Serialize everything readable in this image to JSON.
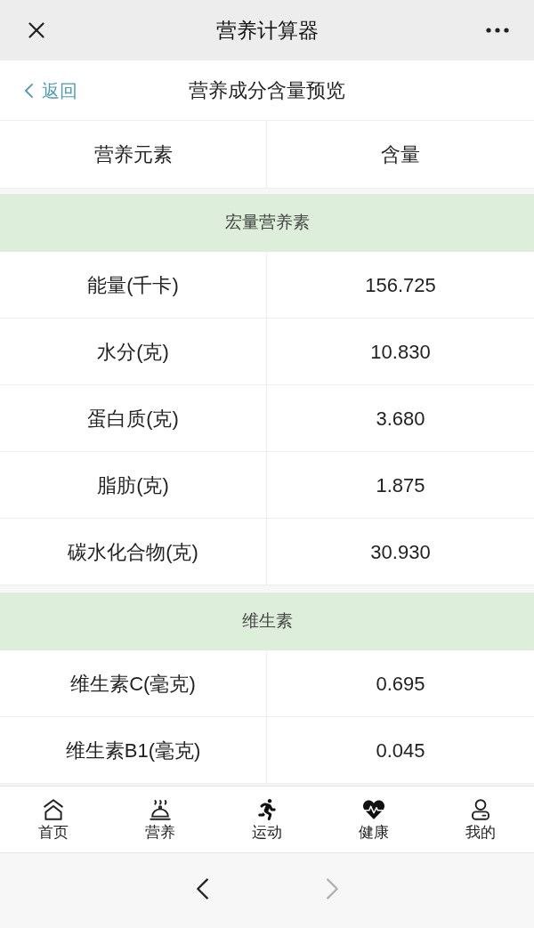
{
  "window": {
    "title": "营养计算器"
  },
  "header": {
    "back_label": "返回",
    "title": "营养成分含量预览"
  },
  "table": {
    "columns": [
      "营养元素",
      "含量"
    ],
    "sections": [
      {
        "title": "宏量营养素",
        "rows": [
          {
            "name": "能量(千卡)",
            "value": "156.725"
          },
          {
            "name": "水分(克)",
            "value": "10.830"
          },
          {
            "name": "蛋白质(克)",
            "value": "3.680"
          },
          {
            "name": "脂肪(克)",
            "value": "1.875"
          },
          {
            "name": "碳水化合物(克)",
            "value": "30.930"
          }
        ]
      },
      {
        "title": "维生素",
        "rows": [
          {
            "name": "维生素C(毫克)",
            "value": "0.695"
          },
          {
            "name": "维生素B1(毫克)",
            "value": "0.045"
          }
        ]
      }
    ]
  },
  "tab_bar": {
    "items": [
      {
        "label": "首页"
      },
      {
        "label": "营养"
      },
      {
        "label": "运动"
      },
      {
        "label": "健康"
      },
      {
        "label": "我的"
      }
    ]
  },
  "browser_nav": {
    "back": {
      "disabled": false
    },
    "forward": {
      "disabled": true
    }
  }
}
